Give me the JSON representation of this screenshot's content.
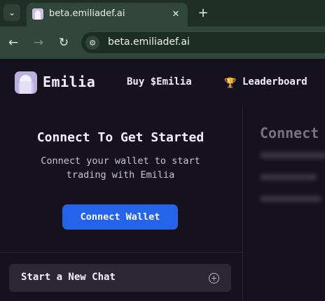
{
  "browser": {
    "tab_title": "beta.emiliadef.ai",
    "url": "beta.emiliadef.ai",
    "icons": {
      "tab_list": "chevron-down-icon",
      "close": "close-icon",
      "new_tab": "plus-icon",
      "back": "arrow-left-icon",
      "forward": "arrow-right-icon",
      "reload": "reload-icon",
      "site_info": "tune-icon"
    }
  },
  "header": {
    "brand": "Emilia",
    "nav": {
      "buy": "Buy $Emilia",
      "leaderboard": "Leaderboard"
    },
    "icons": {
      "logo": "emilia-logo",
      "leaderboard": "trophy-icon"
    }
  },
  "sidebar": {
    "title": "Connect To Get Started",
    "description": "Connect your wallet to start trading with Emilia",
    "connect_button": "Connect Wallet",
    "new_chat": "Start a New Chat"
  },
  "main": {
    "title": "Connect"
  },
  "colors": {
    "browser_frame": "#1f2f27",
    "browser_active": "#32473c",
    "page_background": "#15121d",
    "accent": "#2563eb",
    "card": "#2b2734"
  }
}
